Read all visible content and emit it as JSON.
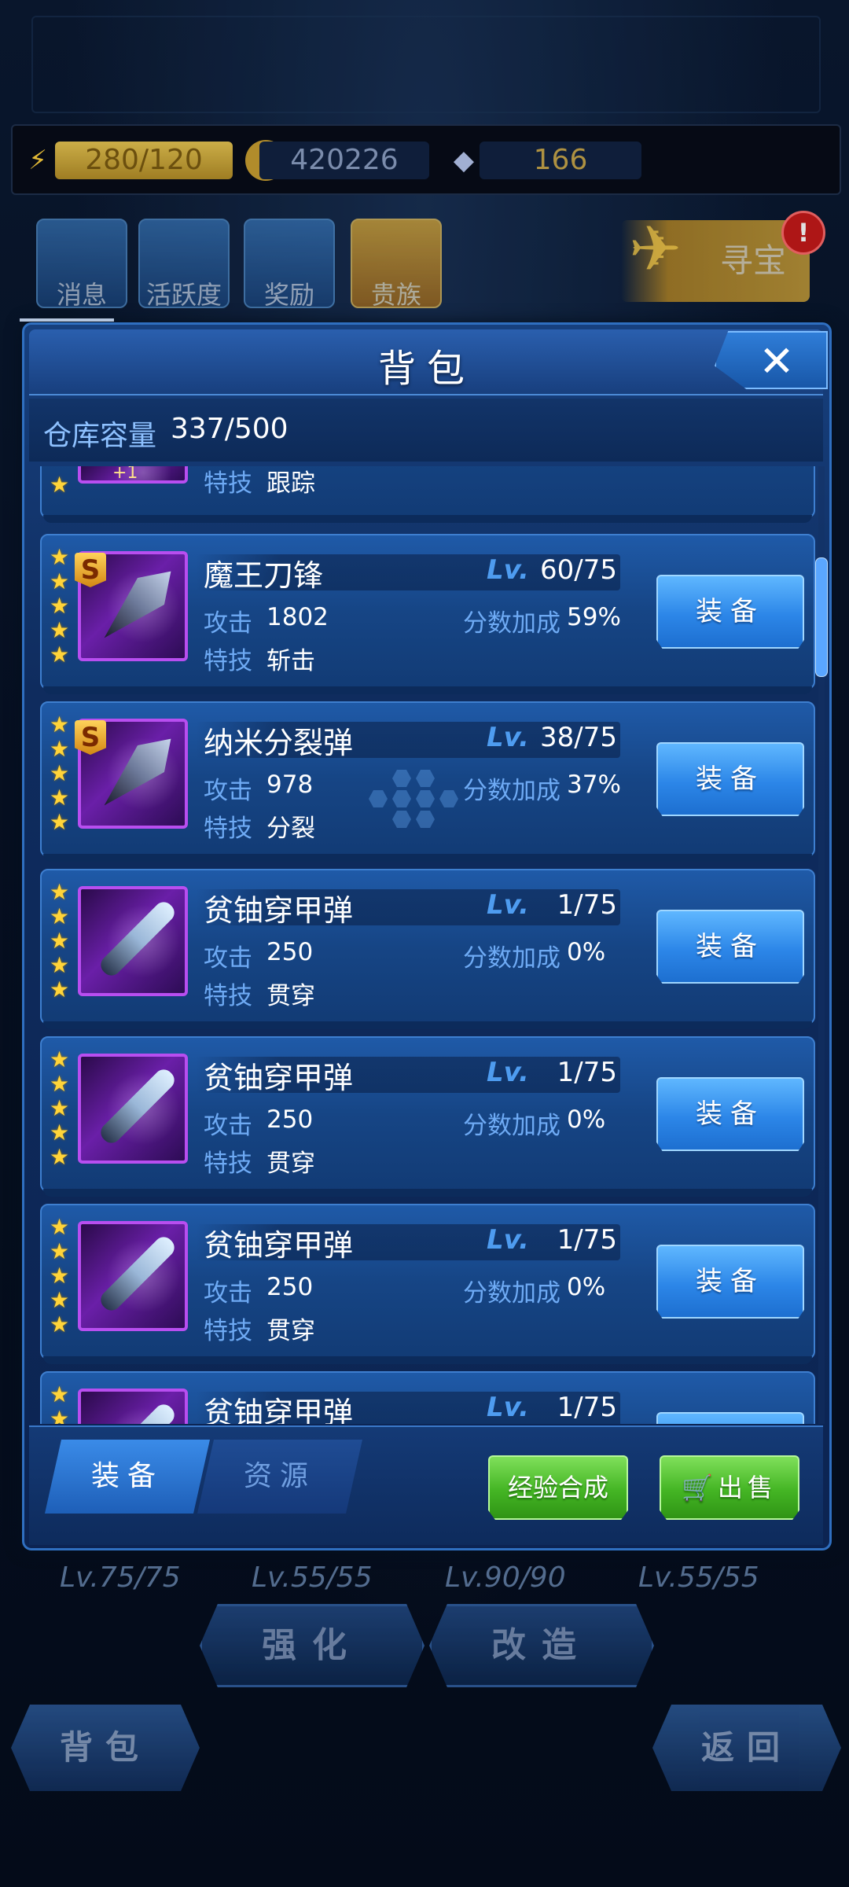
{
  "resources": {
    "energy": "280/120",
    "gold": "420226",
    "gems": "166"
  },
  "top_menu": [
    {
      "label": "消息"
    },
    {
      "label": "活跃度"
    },
    {
      "label": "奖励"
    },
    {
      "label": "贵族"
    }
  ],
  "treasure": {
    "label": "寻宝",
    "badge": "!"
  },
  "dialog": {
    "title": "背包",
    "close_label": "✕",
    "capacity_label": "仓库容量",
    "capacity_value": "337/500"
  },
  "partial_top_item": {
    "badge": "+1",
    "skill_label": "特技",
    "skill": "跟踪"
  },
  "items": [
    {
      "name": "魔王刀锋",
      "lv_label": "Lv.",
      "level": "60/75",
      "attack_label": "攻击",
      "attack": "1802",
      "bonus_label": "分数加成",
      "bonus": "59%",
      "skill_label": "特技",
      "skill": "斩击",
      "grade": "S",
      "stars": 5,
      "button": "装备"
    },
    {
      "name": "纳米分裂弹",
      "lv_label": "Lv.",
      "level": "38/75",
      "attack_label": "攻击",
      "attack": "978",
      "bonus_label": "分数加成",
      "bonus": "37%",
      "skill_label": "特技",
      "skill": "分裂",
      "grade": "S",
      "stars": 5,
      "button": "装备"
    },
    {
      "name": "贫铀穿甲弹",
      "lv_label": "Lv.",
      "level": "1/75",
      "attack_label": "攻击",
      "attack": "250",
      "bonus_label": "分数加成",
      "bonus": "0%",
      "skill_label": "特技",
      "skill": "贯穿",
      "grade": "",
      "stars": 5,
      "button": "装备"
    },
    {
      "name": "贫铀穿甲弹",
      "lv_label": "Lv.",
      "level": "1/75",
      "attack_label": "攻击",
      "attack": "250",
      "bonus_label": "分数加成",
      "bonus": "0%",
      "skill_label": "特技",
      "skill": "贯穿",
      "grade": "",
      "stars": 5,
      "button": "装备"
    },
    {
      "name": "贫铀穿甲弹",
      "lv_label": "Lv.",
      "level": "1/75",
      "attack_label": "攻击",
      "attack": "250",
      "bonus_label": "分数加成",
      "bonus": "0%",
      "skill_label": "特技",
      "skill": "贯穿",
      "grade": "",
      "stars": 5,
      "button": "装备"
    },
    {
      "name": "贫铀穿甲弹",
      "lv_label": "Lv.",
      "level": "1/75",
      "attack_label": "攻击",
      "attack": "",
      "bonus_label": "",
      "bonus": "",
      "skill_label": "",
      "skill": "",
      "grade": "",
      "stars": 2,
      "button": ""
    }
  ],
  "bottom": {
    "tab_equip": "装备",
    "tab_resource": "资源",
    "merge_button": "经验合成",
    "sell_button": "出售"
  },
  "background": {
    "levels": [
      "Lv.75/75",
      "Lv.55/55",
      "Lv.90/90",
      "Lv.55/55"
    ],
    "enhance": "强化",
    "modify": "改造",
    "backpack": "背包",
    "back": "返回"
  }
}
